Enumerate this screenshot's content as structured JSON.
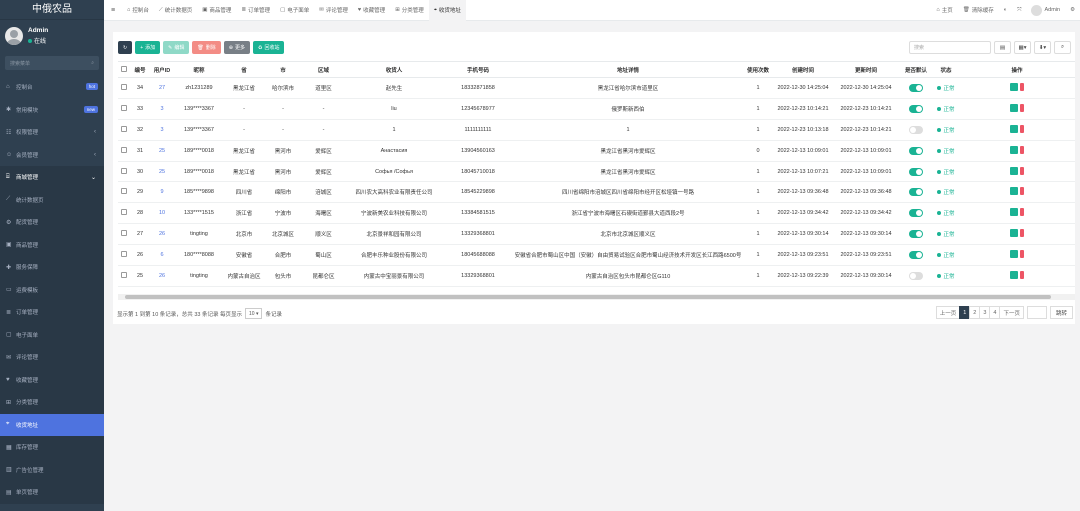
{
  "app": {
    "title": "中俄农品"
  },
  "user": {
    "name": "Admin",
    "status": "在线"
  },
  "sidebar": {
    "search_placeholder": "搜索菜单",
    "items": [
      {
        "label": "控制台",
        "icon": "home-icon",
        "badge": "hot",
        "badge_color": "#4e73df"
      },
      {
        "label": "常用模块",
        "icon": "gear-icon",
        "badge": "new",
        "badge_color": "#4e73df"
      },
      {
        "label": "权限管理",
        "icon": "users-icon",
        "caret": "‹"
      },
      {
        "label": "会员管理",
        "icon": "member-icon",
        "caret": "‹"
      },
      {
        "label": "商城管理",
        "icon": "shop-icon",
        "caret": "⌄"
      }
    ],
    "sub_items": [
      {
        "label": "统计数据页",
        "icon": "chart-icon"
      },
      {
        "label": "配货管理",
        "icon": "distribution-icon"
      },
      {
        "label": "商品管理",
        "icon": "goods-icon"
      },
      {
        "label": "服务保障",
        "icon": "service-icon"
      },
      {
        "label": "运费模板",
        "icon": "freight-icon"
      },
      {
        "label": "订单管理",
        "icon": "order-icon"
      },
      {
        "label": "电子面单",
        "icon": "waybill-icon"
      },
      {
        "label": "评论管理",
        "icon": "comment-icon"
      },
      {
        "label": "收藏管理",
        "icon": "heart-icon"
      },
      {
        "label": "分类管理",
        "icon": "category-icon"
      },
      {
        "label": "收货地址",
        "icon": "address-icon",
        "active": true
      },
      {
        "label": "库存管理",
        "icon": "stock-icon"
      },
      {
        "label": "广告位管理",
        "icon": "ad-icon"
      },
      {
        "label": "单页管理",
        "icon": "page-icon"
      }
    ]
  },
  "topbar": {
    "tabs": [
      {
        "label": "控制台",
        "icon": "home-icon"
      },
      {
        "label": "统计数据页",
        "icon": "chart-icon"
      },
      {
        "label": "商品管理",
        "icon": "goods-icon"
      },
      {
        "label": "订单管理",
        "icon": "order-icon"
      },
      {
        "label": "电子面单",
        "icon": "waybill-icon"
      },
      {
        "label": "评论管理",
        "icon": "comment-icon"
      },
      {
        "label": "收藏管理",
        "icon": "heart-icon"
      },
      {
        "label": "分类管理",
        "icon": "category-icon"
      },
      {
        "label": "收货地址",
        "icon": "address-icon",
        "active": true
      }
    ],
    "home": "主页",
    "clear_cache": "清除缓存",
    "admin": "Admin"
  },
  "toolbar": {
    "add": "添加",
    "edit": "编辑",
    "delete": "删除",
    "more": "更多",
    "recycle": "回收站"
  },
  "search": {
    "placeholder": "搜索"
  },
  "table": {
    "headers": [
      "编号",
      "用户ID",
      "昵称",
      "省",
      "市",
      "区域",
      "收货人",
      "手机号码",
      "地址详情",
      "使用次数",
      "创建时间",
      "更新时间",
      "是否默认",
      "状态",
      "操作"
    ],
    "rows": [
      [
        "34",
        "27",
        "zh1231289",
        "黑龙江省",
        "哈尔滨市",
        "道里区",
        "赵先生",
        "18332871858",
        "黑龙江省哈尔滨市道里区",
        "1",
        "2022-12-30 14:25:04",
        "2022-12-30 14:25:04",
        true,
        "正常"
      ],
      [
        "33",
        "3",
        "139****3367",
        "-",
        "-",
        "-",
        "liu",
        "12345678977",
        "俄罗斯新西伯",
        "1",
        "2022-12-23 10:14:21",
        "2022-12-23 10:14:21",
        true,
        "正常"
      ],
      [
        "32",
        "3",
        "139****3367",
        "-",
        "-",
        "-",
        "1",
        "1111111111",
        "1",
        "1",
        "2022-12-23 10:13:18",
        "2022-12-23 10:14:21",
        false,
        "正常"
      ],
      [
        "31",
        "25",
        "189****0018",
        "黑龙江省",
        "黑河市",
        "爱辉区",
        "Анастасия",
        "13904560163",
        "黑龙江省黑河市爱辉区",
        "0",
        "2022-12-13 10:09:01",
        "2022-12-13 10:09:01",
        true,
        "正常"
      ],
      [
        "30",
        "25",
        "189****0018",
        "黑龙江省",
        "黑河市",
        "爱辉区",
        "Софья /Софья",
        "18045710018",
        "黑龙江省黑河市爱辉区",
        "1",
        "2022-12-13 10:07:21",
        "2022-12-13 10:09:01",
        true,
        "正常"
      ],
      [
        "29",
        "9",
        "185****9898",
        "四川省",
        "绵阳市",
        "涪城区",
        "四川农大高科农业有限责任公司",
        "18545229898",
        "四川省绵阳市涪城区四川省绵阳市经开区松垭镇一号路",
        "1",
        "2022-12-13 09:36:48",
        "2022-12-13 09:36:48",
        true,
        "正常"
      ],
      [
        "28",
        "10",
        "133****1515",
        "浙江省",
        "宁波市",
        "海曙区",
        "宁波新美农业科技有限公司",
        "13384581515",
        "浙江省宁波市海曙区石碶街道鄞县大道西段2号",
        "1",
        "2022-12-13 09:34:42",
        "2022-12-13 09:34:42",
        true,
        "正常"
      ],
      [
        "27",
        "26",
        "tingting",
        "北京市",
        "北京城区",
        "顺义区",
        "北京景祥和园有限公司",
        "13329368801",
        "北京市北京城区顺义区",
        "1",
        "2022-12-13 09:30:14",
        "2022-12-13 09:30:14",
        true,
        "正常"
      ],
      [
        "26",
        "6",
        "180****8088",
        "安徽省",
        "合肥市",
        "蜀山区",
        "合肥丰乐种业股份有限公司",
        "18045688088",
        "安徽省合肥市蜀山区中国（安徽）自由贸易试验区合肥市蜀山经济技术开发区长江西路6500号",
        "1",
        "2022-12-13 09:23:51",
        "2022-12-13 09:23:51",
        true,
        "正常"
      ],
      [
        "25",
        "26",
        "tingting",
        "内蒙古自治区",
        "包头市",
        "昆都仑区",
        "内蒙古中宝丽景有限公司",
        "13329368801",
        "内蒙古自治区包头市昆都仑区G110",
        "1",
        "2022-12-13 09:22:39",
        "2022-12-13 09:30:14",
        false,
        "正常"
      ]
    ]
  },
  "footer": {
    "info_prefix": "显示第 1 到第 10 条记录，总共 33 条记录 每页显示",
    "page_size": "10",
    "info_suffix": "条记录"
  },
  "pagination": {
    "prev": "上一页",
    "pages": [
      "1",
      "2",
      "3",
      "4"
    ],
    "active": "1",
    "next": "下一页",
    "go": "跳转"
  },
  "colors": {
    "sidebar": "#2f4050",
    "accent": "#1ab394",
    "active_menu": "#4e73df",
    "danger": "#ed5565"
  }
}
